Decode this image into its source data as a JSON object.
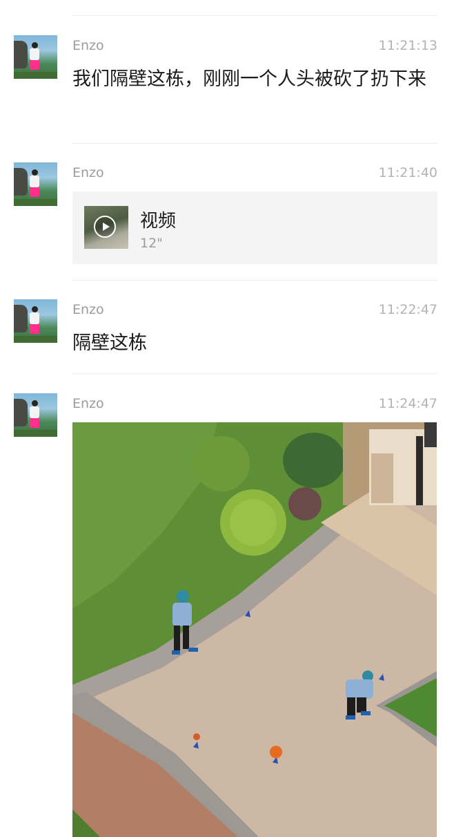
{
  "messages": [
    {
      "sender": "Enzo",
      "time": "11:21:13",
      "type": "text",
      "text": "我们隔壁这栋，刚刚一个人头被砍了扔下来"
    },
    {
      "sender": "Enzo",
      "time": "11:21:40",
      "type": "video",
      "video": {
        "label": "视频",
        "duration": "12\""
      }
    },
    {
      "sender": "Enzo",
      "time": "11:22:47",
      "type": "text",
      "text": "隔壁这栋"
    },
    {
      "sender": "Enzo",
      "time": "11:24:47",
      "type": "image"
    }
  ],
  "colors": {
    "background": "#ffffff",
    "sender_text": "#9b9b9b",
    "time_text": "#b3b3b3",
    "message_text": "#1a1a1a",
    "video_card_bg": "#f4f4f4",
    "divider": "#ececec"
  }
}
